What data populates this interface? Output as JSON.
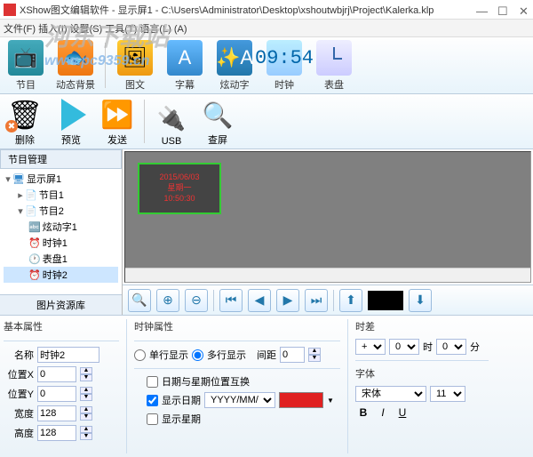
{
  "window": {
    "title": "XShow图文编辑软件 - 显示屏1 - C:\\Users\\Administrator\\Desktop\\xshoutwbjrj\\Project\\Kalerka.klp",
    "min": "—",
    "max": "☐",
    "close": "✕"
  },
  "menu": {
    "text": "文件(F)  插入(I)  设置(S)  工具(T)  语言(L)  (A)"
  },
  "watermark": {
    "main": "河东下载站",
    "url": "www.pc9359.cn"
  },
  "ribbon": {
    "program": "节目",
    "bg": "动态背景",
    "text": "图文",
    "sub": "字幕",
    "dyn": "炫动字",
    "clock": "时钟",
    "clock_val": "09:54",
    "dial": "表盘"
  },
  "toolbar2": {
    "del": "删除",
    "preview": "预览",
    "send": "发送",
    "usb": "USB",
    "find": "查屏"
  },
  "sidebar": {
    "tab": "节目管理",
    "reslib": "图片资源库",
    "tree": {
      "root": "显示屏1",
      "p1": "节目1",
      "p2": "节目2",
      "dyn": "炫动字1",
      "clk1": "时钟1",
      "dial1": "表盘1",
      "clk2": "时钟2"
    }
  },
  "preview": {
    "date": "2015/06/03",
    "week": "星期一",
    "time": "10:50:30"
  },
  "zoombar": {
    "black": ""
  },
  "props": {
    "basic_title": "基本属性",
    "name_label": "名称",
    "name_val": "时钟2",
    "x_label": "位置X",
    "x_val": "0",
    "y_label": "位置Y",
    "y_val": "0",
    "w_label": "宽度",
    "w_val": "128",
    "h_label": "高度",
    "h_val": "128"
  },
  "clock": {
    "title": "时钟属性",
    "single": "单行显示",
    "multi": "多行显示",
    "gap_label": "间距",
    "gap_val": "0",
    "swap": "日期与星期位置互换",
    "show_date": "显示日期",
    "date_fmt": "YYYY/MM/DD",
    "show_week_partial": "显示星期"
  },
  "tz": {
    "title": "时差",
    "sign": "+",
    "h": "0",
    "hl": "时",
    "m": "0",
    "ml": "分"
  },
  "font": {
    "title": "字体",
    "family": "宋体",
    "size": "11",
    "b": "B",
    "i": "I",
    "u": "U"
  },
  "colors": {
    "date_color": "#e02020"
  },
  "chart_data": null
}
